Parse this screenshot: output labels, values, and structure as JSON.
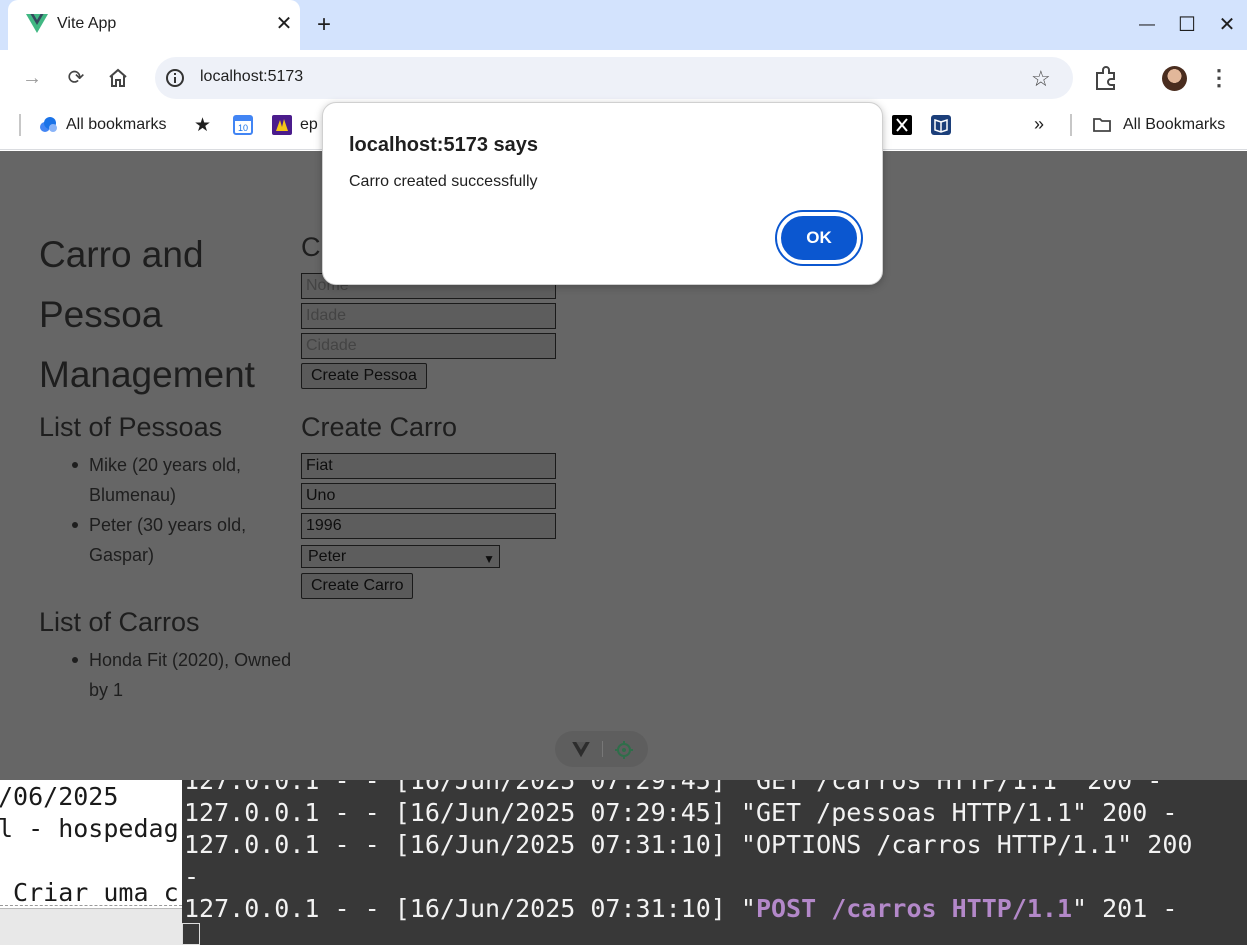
{
  "browser": {
    "tab_title": "Vite App",
    "tab_close": "✕",
    "new_tab": "+",
    "window_controls": {
      "minimize": "—",
      "maximize": "☐",
      "close": "✕"
    },
    "url": "localhost:5173",
    "bookmarks": [
      "All bookmarks",
      "ep",
      "All Bookmarks"
    ],
    "overflow": "»"
  },
  "page": {
    "title_lines": [
      "Carro and",
      "Pessoa",
      "Management"
    ],
    "pessoas_heading": "List of Pessoas",
    "pessoas": [
      [
        "Mike (20 years old,",
        "Blumenau)"
      ],
      [
        "Peter (30 years old,",
        "Gaspar)"
      ]
    ],
    "carros_heading": "List of Carros",
    "carros": [
      [
        "Honda Fit (2020), Owned",
        "by 1"
      ]
    ],
    "create_pessoa_heading": "C",
    "pessoa_form": {
      "nome_placeholder": "Nome",
      "idade_placeholder": "Idade",
      "cidade_placeholder": "Cidade",
      "submit": "Create Pessoa"
    },
    "create_carro_heading": "Create Carro",
    "carro_form": {
      "marca": "Fiat",
      "modelo": "Uno",
      "ano": "1996",
      "owner": "Peter",
      "submit": "Create Carro"
    }
  },
  "dialog": {
    "title": "localhost:5173 says",
    "message": "Carro created successfully",
    "ok": "OK"
  },
  "terminal_left": [
    "/06/2025",
    "l - hospedag",
    "",
    " Criar uma c"
  ],
  "terminal_right": {
    "lines": [
      "127.0.0.1 - - [16/Jun/2025 07:29:45] \"GET /carros HTTP/1.1\" 200 -",
      "127.0.0.1 - - [16/Jun/2025 07:29:45] \"GET /pessoas HTTP/1.1\" 200 -",
      "127.0.0.1 - - [16/Jun/2025 07:31:10] \"OPTIONS /carros HTTP/1.1\" 200",
      "-"
    ],
    "last_prefix": "127.0.0.1 - - [16/Jun/2025 07:31:10] \"",
    "last_highlight": "POST /carros HTTP/1.1",
    "last_suffix": "\" 201 -"
  }
}
